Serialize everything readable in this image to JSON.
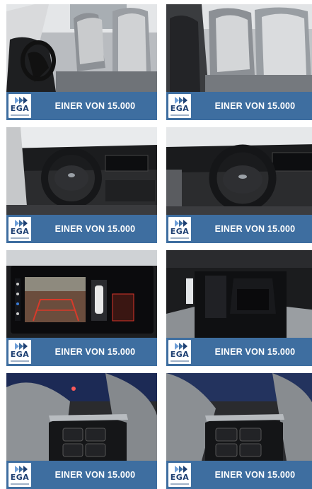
{
  "gallery": {
    "tiles": [
      {
        "image": "front-seats-driver-side",
        "logo_text": "EGA",
        "banner_text": "EINER VON 15.000"
      },
      {
        "image": "front-seats-passenger-side",
        "logo_text": "EGA",
        "banner_text": "EINER VON 15.000"
      },
      {
        "image": "steering-wheel-dashboard-left",
        "logo_text": "EGA",
        "banner_text": "EINER VON 15.000"
      },
      {
        "image": "steering-wheel-dashboard-right",
        "logo_text": "EGA",
        "banner_text": "EINER VON 15.000"
      },
      {
        "image": "infotainment-rear-camera-screen",
        "logo_text": "EGA",
        "banner_text": "EINER VON 15.000"
      },
      {
        "image": "center-console",
        "logo_text": "EGA",
        "banner_text": "EINER VON 15.000"
      },
      {
        "image": "steering-wheel-left-controls",
        "logo_text": "EGA",
        "banner_text": "EINER VON 15.000"
      },
      {
        "image": "steering-wheel-right-controls",
        "logo_text": "EGA",
        "banner_text": "EINER VON 15.000"
      }
    ]
  },
  "colors": {
    "banner": "#3e6ea0",
    "logo_blue": "#1d3f72",
    "logo_light_blue": "#6f9fd8"
  }
}
